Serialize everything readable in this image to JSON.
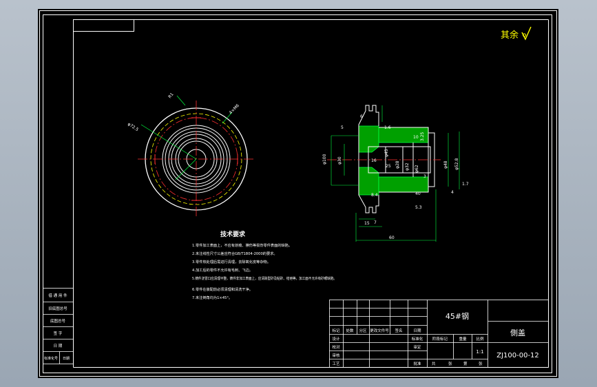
{
  "surface_finish": {
    "text": "其余"
  },
  "part_material": "45#钢",
  "part_name": "側盖",
  "drawing_number": "ZJ100-00-12",
  "scale": "1:1",
  "notes": {
    "heading": "技术要求",
    "items": [
      "1.零件加工表面上，不应有划痕、擦伤等损伤零件表面的缺陷。",
      "2.未注线性尺寸公差应符合GB/T1804-2000的要求。",
      "3.零件热处理后需进行清理，去除氧化皮等杂物。",
      "4.加工后的零件不允许有毛刺、飞边。",
      "5.铸件浇冒口应清理平整，铸件非加工表面上，应清除型砂及粘砂、结疤等，加工面不允许有砂眼缺陷。",
      "6.零件在装配前必须清理和清洗干净。",
      "7.未注倒角均为1×45°。"
    ]
  },
  "side_table": {
    "rows": [
      "借 通 用 件",
      "旧底图总号",
      "底图总号",
      "签 字",
      "日 期"
    ],
    "footer": [
      "标准化号",
      "日期"
    ]
  },
  "title_block": {
    "change_header": [
      "标记",
      "处数",
      "分区",
      "更改文件号",
      "签名",
      "日期"
    ],
    "sign_rows": [
      "设计",
      "校对",
      "审核",
      "工艺"
    ],
    "sign_right": [
      "标准化",
      "审定",
      "批准"
    ],
    "stage_header": [
      "阶段标记",
      "重量",
      "比例"
    ],
    "sheet_line": [
      "共",
      "张",
      "第",
      "张"
    ]
  },
  "dims": {
    "left": [
      "R1",
      "4×M6",
      "φ72.5"
    ],
    "right": [
      "φ100",
      "φ30",
      "φ45",
      "φ28",
      "φ32",
      "φ62",
      "φ48",
      "φ52.8",
      "16",
      "25",
      "8.4",
      "3.25",
      "10",
      "40",
      "7",
      "6",
      "15",
      "5",
      "5.3",
      "60",
      "3",
      "4",
      "1.7",
      "1.6"
    ]
  }
}
